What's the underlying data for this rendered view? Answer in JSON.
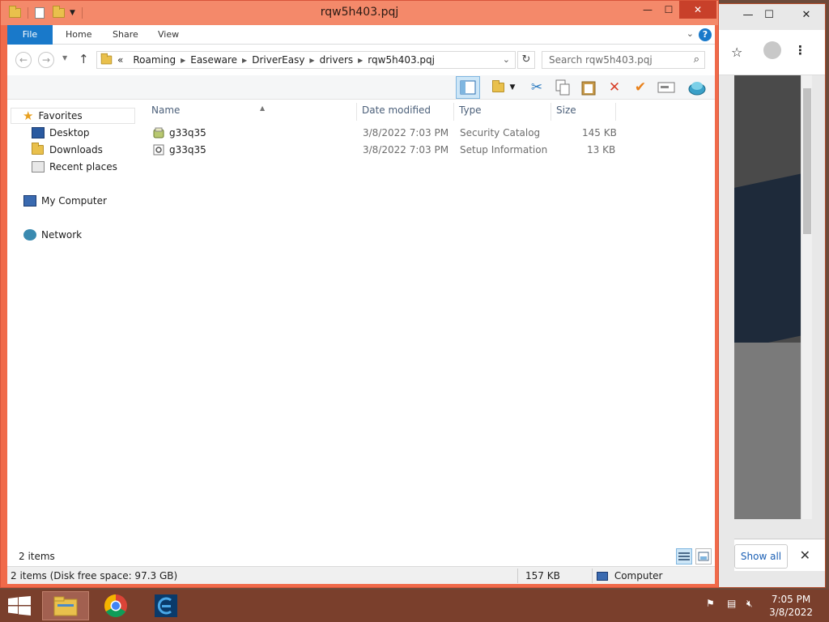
{
  "window": {
    "title": "rqw5h403.pqj",
    "minimize": "—",
    "maximize": "☐",
    "close": "✕"
  },
  "ribbon": {
    "tabs": [
      "File",
      "Home",
      "Share",
      "View"
    ],
    "help": "?"
  },
  "address": {
    "overflow": "«",
    "breadcrumbs": [
      "Roaming",
      "Easeware",
      "DriverEasy",
      "drivers",
      "rqw5h403.pqj"
    ],
    "search_placeholder": "Search rqw5h403.pqj"
  },
  "nav": {
    "favorites": "Favorites",
    "desktop": "Desktop",
    "downloads": "Downloads",
    "recent": "Recent places",
    "computer": "My Computer",
    "network": "Network"
  },
  "columns": [
    "Name",
    "Date modified",
    "Type",
    "Size"
  ],
  "files": [
    {
      "name": "g33q35",
      "date": "3/8/2022 7:03 PM",
      "type": "Security Catalog",
      "size": "145 KB"
    },
    {
      "name": "g33q35",
      "date": "3/8/2022 7:03 PM",
      "type": "Setup Information",
      "size": "13 KB"
    }
  ],
  "status": {
    "item_count": "2 items",
    "detail": "2 items (Disk free space: 97.3 GB)",
    "total_size": "157 KB",
    "location": "Computer"
  },
  "bg_window": {
    "show_all": "Show all",
    "close": "✕"
  },
  "taskbar": {
    "time": "7:05 PM",
    "date": "3/8/2022"
  },
  "colors": {
    "window_frame": "#f06a4a",
    "accent": "#1979ca",
    "taskbar": "#7a3f2c"
  }
}
